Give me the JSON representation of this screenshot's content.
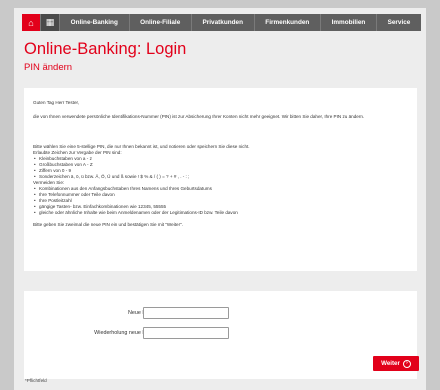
{
  "nav": {
    "home_icon": "home-icon",
    "grid_icon": "grid-icon",
    "items": [
      "Online-Banking",
      "Online-Filiale",
      "Privatkunden",
      "Firmenkunden",
      "Immobilien",
      "Service"
    ]
  },
  "page": {
    "title": "Online-Banking: Login",
    "subtitle": "PIN ändern"
  },
  "message": {
    "greeting": "Guten Tag Herr Tester,",
    "intro": "die von Ihnen verwendete persönliche Identifikations-Nummer (PIN) ist zur Absicherung Ihrer Konten nicht mehr geeignet. Wir bitten Sie daher, Ihre PIN zu ändern.",
    "instruction": "Bitte wählen Sie eine 5-stellige PIN, die nur Ihnen bekannt ist, und notieren oder speichern Sie diese nicht.",
    "allowed_heading": "Erlaubte Zeichen zur Vergabe der PIN sind:",
    "allowed": [
      "Kleinbuchstaben von a - z",
      "Großbuchstaben von A - Z",
      "Ziffern von 0 - 9",
      "Sonderzeichen ä, ö, ü bzw. Ä, Ö, Ü und ß sowie ! $ % & / ( ) = ? + # , . - : ;"
    ],
    "avoid_heading": "Vermeiden Sie:",
    "avoid": [
      "Kombinationen aus den Anfangsbuchstaben Ihres Namens und Ihres Geburtsdatums",
      "Ihre Telefonnummer oder Teile davon",
      "Ihre Postleitzahl",
      "gängige Tasten- bzw. Einfachkombinationen wie 12345, 55555",
      "gleiche oder ähnliche Inhalte wie beim Anmeldenamen oder der Legitimations-ID bzw. Teile davon"
    ],
    "closing": "Bitte geben Sie zweimal die neue PIN ein und bestätigen Sie mit \"Weiter\"."
  },
  "form": {
    "new_pin_label": "Neue PIN*:",
    "new_pin_value": "",
    "repeat_pin_label": "Wiederholung neue PIN*:",
    "repeat_pin_value": "",
    "submit_label": "Weiter",
    "submit_icon": "chevron-right-icon"
  },
  "footnote": "*Pflichtfeld",
  "colors": {
    "accent": "#e2001a",
    "nav_bg": "#5f5f5f",
    "page_bg": "#c9c9c9",
    "frame_bg": "#ededed"
  }
}
